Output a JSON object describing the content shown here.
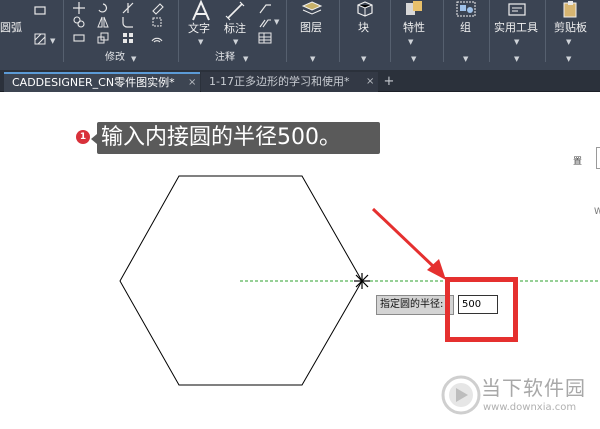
{
  "ribbon": {
    "arc_label": "圆弧",
    "modify_panel": "修改",
    "text_label": "文字",
    "dimension_label": "标注",
    "annotation_panel": "注释",
    "layers_label": "图层",
    "block_label": "块",
    "properties_label": "特性",
    "groups_label": "组",
    "utilities_label": "实用工具",
    "clipboard_label": "剪贴板"
  },
  "tabs": [
    {
      "label": "CADDESIGNER_CN零件图实例*",
      "close": "×"
    },
    {
      "label": "1-17正多边形的学习和使用*",
      "close": "×"
    }
  ],
  "tab_add": "+",
  "canvas": {
    "step_number": "1",
    "instruction": "输入内接圆的半径500。",
    "prompt_label": "指定圆的半径:",
    "radius_value": "500",
    "right_edge_label": "置",
    "right_edge_letter": "W"
  },
  "watermark": {
    "name": "当下软件园",
    "url": "www.downxia.com"
  },
  "colors": {
    "ribbon_bg": "#3b4453",
    "tab_bg": "#2b313b",
    "highlight": "#e5302f",
    "guide_line": "#2ea02e",
    "instruction_bg": "#5a5a5a"
  }
}
